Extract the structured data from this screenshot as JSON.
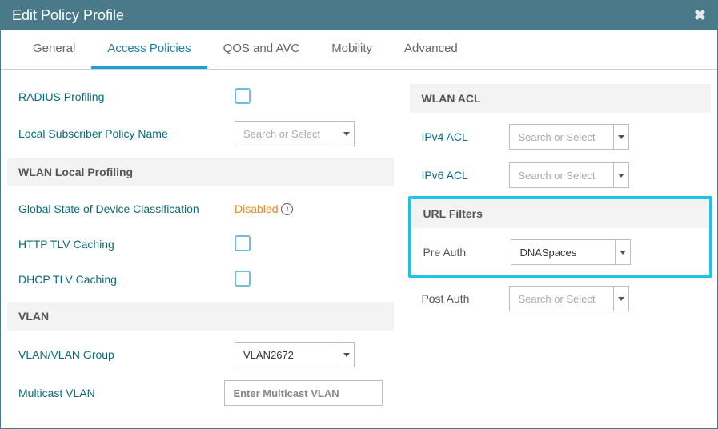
{
  "header": {
    "title": "Edit Policy Profile"
  },
  "tabs": [
    "General",
    "Access Policies",
    "QOS and AVC",
    "Mobility",
    "Advanced"
  ],
  "active_tab": 1,
  "left": {
    "radius_profiling": "RADIUS Profiling",
    "local_sub_policy": "Local Subscriber Policy Name",
    "local_sub_placeholder": "Search or Select",
    "wlan_local_profiling": "WLAN Local Profiling",
    "global_state": "Global State of Device Classification",
    "global_state_value": "Disabled",
    "http_tlv": "HTTP TLV Caching",
    "dhcp_tlv": "DHCP TLV Caching",
    "vlan_section": "VLAN",
    "vlan_group": "VLAN/VLAN Group",
    "vlan_group_value": "VLAN2672",
    "multicast_vlan": "Multicast VLAN",
    "multicast_placeholder": "Enter Multicast VLAN"
  },
  "right": {
    "wlan_acl": "WLAN ACL",
    "ipv4_acl": "IPv4 ACL",
    "ipv6_acl": "IPv6 ACL",
    "acl_placeholder": "Search or Select",
    "url_filters": "URL Filters",
    "pre_auth": "Pre Auth",
    "pre_auth_value": "DNASpaces",
    "post_auth": "Post Auth",
    "post_auth_placeholder": "Search or Select"
  }
}
